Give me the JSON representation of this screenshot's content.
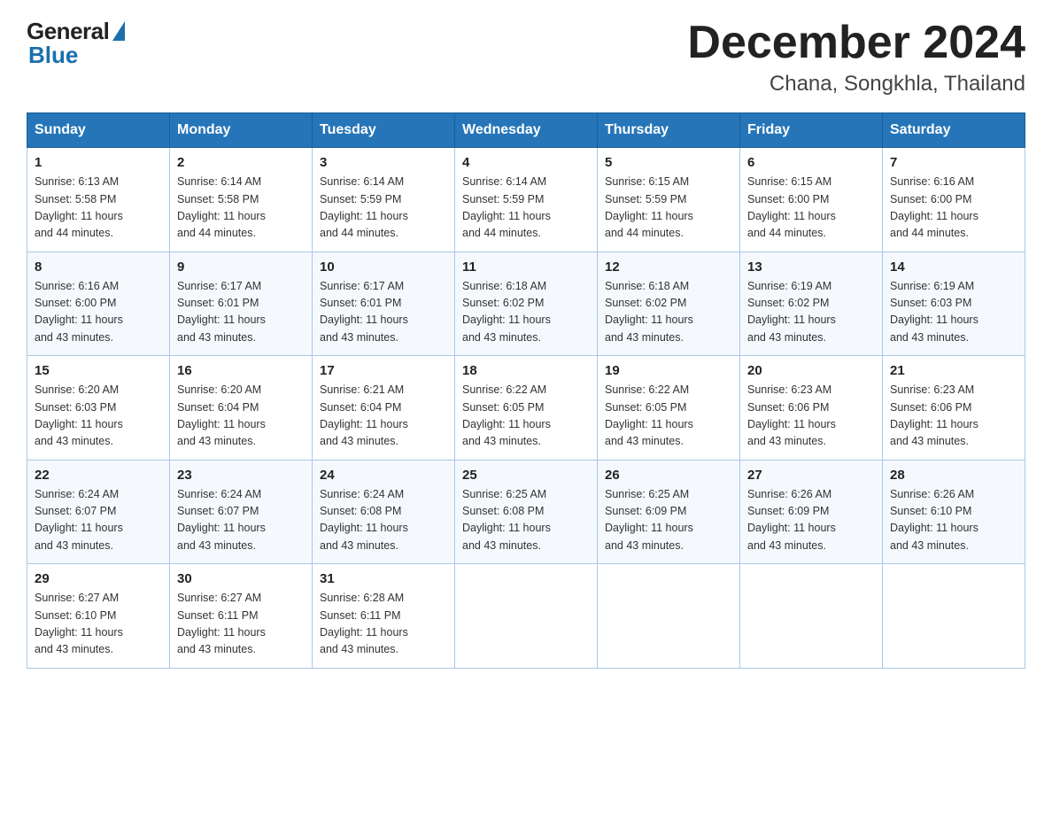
{
  "logo": {
    "general": "General",
    "blue": "Blue"
  },
  "title": "December 2024",
  "location": "Chana, Songkhla, Thailand",
  "days_of_week": [
    "Sunday",
    "Monday",
    "Tuesday",
    "Wednesday",
    "Thursday",
    "Friday",
    "Saturday"
  ],
  "weeks": [
    [
      {
        "day": "1",
        "sunrise": "6:13 AM",
        "sunset": "5:58 PM",
        "daylight": "11 hours and 44 minutes."
      },
      {
        "day": "2",
        "sunrise": "6:14 AM",
        "sunset": "5:58 PM",
        "daylight": "11 hours and 44 minutes."
      },
      {
        "day": "3",
        "sunrise": "6:14 AM",
        "sunset": "5:59 PM",
        "daylight": "11 hours and 44 minutes."
      },
      {
        "day": "4",
        "sunrise": "6:14 AM",
        "sunset": "5:59 PM",
        "daylight": "11 hours and 44 minutes."
      },
      {
        "day": "5",
        "sunrise": "6:15 AM",
        "sunset": "5:59 PM",
        "daylight": "11 hours and 44 minutes."
      },
      {
        "day": "6",
        "sunrise": "6:15 AM",
        "sunset": "6:00 PM",
        "daylight": "11 hours and 44 minutes."
      },
      {
        "day": "7",
        "sunrise": "6:16 AM",
        "sunset": "6:00 PM",
        "daylight": "11 hours and 44 minutes."
      }
    ],
    [
      {
        "day": "8",
        "sunrise": "6:16 AM",
        "sunset": "6:00 PM",
        "daylight": "11 hours and 43 minutes."
      },
      {
        "day": "9",
        "sunrise": "6:17 AM",
        "sunset": "6:01 PM",
        "daylight": "11 hours and 43 minutes."
      },
      {
        "day": "10",
        "sunrise": "6:17 AM",
        "sunset": "6:01 PM",
        "daylight": "11 hours and 43 minutes."
      },
      {
        "day": "11",
        "sunrise": "6:18 AM",
        "sunset": "6:02 PM",
        "daylight": "11 hours and 43 minutes."
      },
      {
        "day": "12",
        "sunrise": "6:18 AM",
        "sunset": "6:02 PM",
        "daylight": "11 hours and 43 minutes."
      },
      {
        "day": "13",
        "sunrise": "6:19 AM",
        "sunset": "6:02 PM",
        "daylight": "11 hours and 43 minutes."
      },
      {
        "day": "14",
        "sunrise": "6:19 AM",
        "sunset": "6:03 PM",
        "daylight": "11 hours and 43 minutes."
      }
    ],
    [
      {
        "day": "15",
        "sunrise": "6:20 AM",
        "sunset": "6:03 PM",
        "daylight": "11 hours and 43 minutes."
      },
      {
        "day": "16",
        "sunrise": "6:20 AM",
        "sunset": "6:04 PM",
        "daylight": "11 hours and 43 minutes."
      },
      {
        "day": "17",
        "sunrise": "6:21 AM",
        "sunset": "6:04 PM",
        "daylight": "11 hours and 43 minutes."
      },
      {
        "day": "18",
        "sunrise": "6:22 AM",
        "sunset": "6:05 PM",
        "daylight": "11 hours and 43 minutes."
      },
      {
        "day": "19",
        "sunrise": "6:22 AM",
        "sunset": "6:05 PM",
        "daylight": "11 hours and 43 minutes."
      },
      {
        "day": "20",
        "sunrise": "6:23 AM",
        "sunset": "6:06 PM",
        "daylight": "11 hours and 43 minutes."
      },
      {
        "day": "21",
        "sunrise": "6:23 AM",
        "sunset": "6:06 PM",
        "daylight": "11 hours and 43 minutes."
      }
    ],
    [
      {
        "day": "22",
        "sunrise": "6:24 AM",
        "sunset": "6:07 PM",
        "daylight": "11 hours and 43 minutes."
      },
      {
        "day": "23",
        "sunrise": "6:24 AM",
        "sunset": "6:07 PM",
        "daylight": "11 hours and 43 minutes."
      },
      {
        "day": "24",
        "sunrise": "6:24 AM",
        "sunset": "6:08 PM",
        "daylight": "11 hours and 43 minutes."
      },
      {
        "day": "25",
        "sunrise": "6:25 AM",
        "sunset": "6:08 PM",
        "daylight": "11 hours and 43 minutes."
      },
      {
        "day": "26",
        "sunrise": "6:25 AM",
        "sunset": "6:09 PM",
        "daylight": "11 hours and 43 minutes."
      },
      {
        "day": "27",
        "sunrise": "6:26 AM",
        "sunset": "6:09 PM",
        "daylight": "11 hours and 43 minutes."
      },
      {
        "day": "28",
        "sunrise": "6:26 AM",
        "sunset": "6:10 PM",
        "daylight": "11 hours and 43 minutes."
      }
    ],
    [
      {
        "day": "29",
        "sunrise": "6:27 AM",
        "sunset": "6:10 PM",
        "daylight": "11 hours and 43 minutes."
      },
      {
        "day": "30",
        "sunrise": "6:27 AM",
        "sunset": "6:11 PM",
        "daylight": "11 hours and 43 minutes."
      },
      {
        "day": "31",
        "sunrise": "6:28 AM",
        "sunset": "6:11 PM",
        "daylight": "11 hours and 43 minutes."
      },
      null,
      null,
      null,
      null
    ]
  ],
  "labels": {
    "sunrise": "Sunrise:",
    "sunset": "Sunset:",
    "daylight": "Daylight:"
  }
}
